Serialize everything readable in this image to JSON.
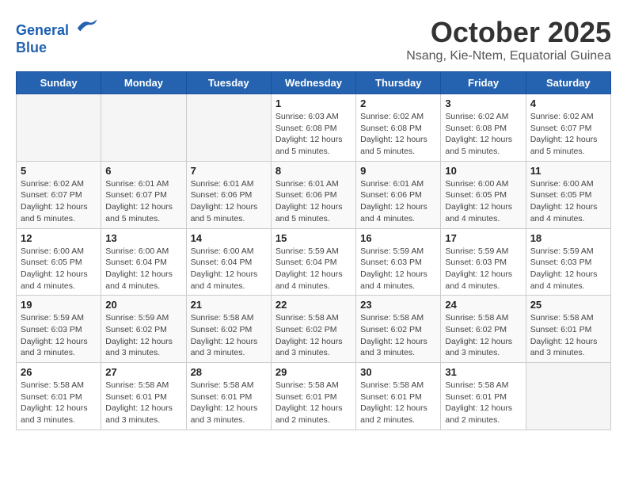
{
  "logo": {
    "line1": "General",
    "line2": "Blue"
  },
  "title": "October 2025",
  "location": "Nsang, Kie-Ntem, Equatorial Guinea",
  "weekdays": [
    "Sunday",
    "Monday",
    "Tuesday",
    "Wednesday",
    "Thursday",
    "Friday",
    "Saturday"
  ],
  "weeks": [
    [
      {
        "day": "",
        "info": ""
      },
      {
        "day": "",
        "info": ""
      },
      {
        "day": "",
        "info": ""
      },
      {
        "day": "1",
        "info": "Sunrise: 6:03 AM\nSunset: 6:08 PM\nDaylight: 12 hours\nand 5 minutes."
      },
      {
        "day": "2",
        "info": "Sunrise: 6:02 AM\nSunset: 6:08 PM\nDaylight: 12 hours\nand 5 minutes."
      },
      {
        "day": "3",
        "info": "Sunrise: 6:02 AM\nSunset: 6:08 PM\nDaylight: 12 hours\nand 5 minutes."
      },
      {
        "day": "4",
        "info": "Sunrise: 6:02 AM\nSunset: 6:07 PM\nDaylight: 12 hours\nand 5 minutes."
      }
    ],
    [
      {
        "day": "5",
        "info": "Sunrise: 6:02 AM\nSunset: 6:07 PM\nDaylight: 12 hours\nand 5 minutes."
      },
      {
        "day": "6",
        "info": "Sunrise: 6:01 AM\nSunset: 6:07 PM\nDaylight: 12 hours\nand 5 minutes."
      },
      {
        "day": "7",
        "info": "Sunrise: 6:01 AM\nSunset: 6:06 PM\nDaylight: 12 hours\nand 5 minutes."
      },
      {
        "day": "8",
        "info": "Sunrise: 6:01 AM\nSunset: 6:06 PM\nDaylight: 12 hours\nand 5 minutes."
      },
      {
        "day": "9",
        "info": "Sunrise: 6:01 AM\nSunset: 6:06 PM\nDaylight: 12 hours\nand 4 minutes."
      },
      {
        "day": "10",
        "info": "Sunrise: 6:00 AM\nSunset: 6:05 PM\nDaylight: 12 hours\nand 4 minutes."
      },
      {
        "day": "11",
        "info": "Sunrise: 6:00 AM\nSunset: 6:05 PM\nDaylight: 12 hours\nand 4 minutes."
      }
    ],
    [
      {
        "day": "12",
        "info": "Sunrise: 6:00 AM\nSunset: 6:05 PM\nDaylight: 12 hours\nand 4 minutes."
      },
      {
        "day": "13",
        "info": "Sunrise: 6:00 AM\nSunset: 6:04 PM\nDaylight: 12 hours\nand 4 minutes."
      },
      {
        "day": "14",
        "info": "Sunrise: 6:00 AM\nSunset: 6:04 PM\nDaylight: 12 hours\nand 4 minutes."
      },
      {
        "day": "15",
        "info": "Sunrise: 5:59 AM\nSunset: 6:04 PM\nDaylight: 12 hours\nand 4 minutes."
      },
      {
        "day": "16",
        "info": "Sunrise: 5:59 AM\nSunset: 6:03 PM\nDaylight: 12 hours\nand 4 minutes."
      },
      {
        "day": "17",
        "info": "Sunrise: 5:59 AM\nSunset: 6:03 PM\nDaylight: 12 hours\nand 4 minutes."
      },
      {
        "day": "18",
        "info": "Sunrise: 5:59 AM\nSunset: 6:03 PM\nDaylight: 12 hours\nand 4 minutes."
      }
    ],
    [
      {
        "day": "19",
        "info": "Sunrise: 5:59 AM\nSunset: 6:03 PM\nDaylight: 12 hours\nand 3 minutes."
      },
      {
        "day": "20",
        "info": "Sunrise: 5:59 AM\nSunset: 6:02 PM\nDaylight: 12 hours\nand 3 minutes."
      },
      {
        "day": "21",
        "info": "Sunrise: 5:58 AM\nSunset: 6:02 PM\nDaylight: 12 hours\nand 3 minutes."
      },
      {
        "day": "22",
        "info": "Sunrise: 5:58 AM\nSunset: 6:02 PM\nDaylight: 12 hours\nand 3 minutes."
      },
      {
        "day": "23",
        "info": "Sunrise: 5:58 AM\nSunset: 6:02 PM\nDaylight: 12 hours\nand 3 minutes."
      },
      {
        "day": "24",
        "info": "Sunrise: 5:58 AM\nSunset: 6:02 PM\nDaylight: 12 hours\nand 3 minutes."
      },
      {
        "day": "25",
        "info": "Sunrise: 5:58 AM\nSunset: 6:01 PM\nDaylight: 12 hours\nand 3 minutes."
      }
    ],
    [
      {
        "day": "26",
        "info": "Sunrise: 5:58 AM\nSunset: 6:01 PM\nDaylight: 12 hours\nand 3 minutes."
      },
      {
        "day": "27",
        "info": "Sunrise: 5:58 AM\nSunset: 6:01 PM\nDaylight: 12 hours\nand 3 minutes."
      },
      {
        "day": "28",
        "info": "Sunrise: 5:58 AM\nSunset: 6:01 PM\nDaylight: 12 hours\nand 3 minutes."
      },
      {
        "day": "29",
        "info": "Sunrise: 5:58 AM\nSunset: 6:01 PM\nDaylight: 12 hours\nand 2 minutes."
      },
      {
        "day": "30",
        "info": "Sunrise: 5:58 AM\nSunset: 6:01 PM\nDaylight: 12 hours\nand 2 minutes."
      },
      {
        "day": "31",
        "info": "Sunrise: 5:58 AM\nSunset: 6:01 PM\nDaylight: 12 hours\nand 2 minutes."
      },
      {
        "day": "",
        "info": ""
      }
    ]
  ]
}
